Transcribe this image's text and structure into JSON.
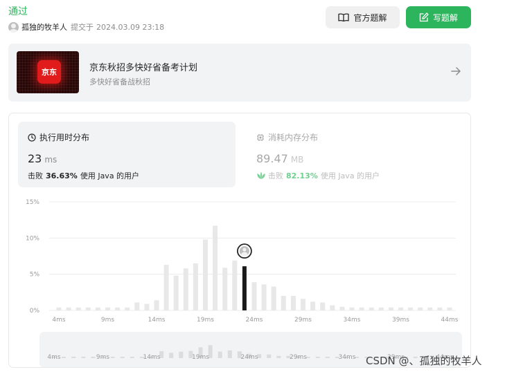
{
  "header": {
    "status": "通过",
    "username": "孤独的牧羊人",
    "submitted_label": "提交于",
    "submitted_time": "2024.03.09 23:18",
    "official_solution_label": "官方题解",
    "write_solution_label": "写题解"
  },
  "promo": {
    "logo_text": "京东",
    "title": "京东秋招多快好省备考计划",
    "subtitle": "多快好省备战秋招"
  },
  "tabs": {
    "runtime": {
      "title": "执行用时分布",
      "value": "23",
      "unit": "ms",
      "beat_prefix": "击败",
      "beat_pct": "36.63%",
      "beat_suffix": "使用 Java 的用户"
    },
    "memory": {
      "title": "消耗内存分布",
      "value": "89.47",
      "unit": "MB",
      "beat_prefix": "击败",
      "beat_pct": "82.13%",
      "beat_suffix": "使用 Java 的用户"
    }
  },
  "chart_data": {
    "type": "bar",
    "x_unit": "ms",
    "x_start": 4,
    "x_step": 1,
    "values": [
      0.4,
      0.4,
      0.4,
      0.4,
      0.4,
      0.4,
      0.4,
      0.4,
      1.1,
      0.9,
      1.4,
      6.3,
      4.8,
      5.8,
      6.5,
      9.8,
      11.7,
      5.9,
      6.9,
      6.1,
      3.9,
      3.6,
      3.3,
      2.0,
      2.0,
      1.6,
      1.2,
      1.1,
      0.7,
      0.5,
      0.4,
      0.4,
      0.4,
      0.4,
      0.4,
      0.4,
      0.4,
      0.4,
      0.4,
      0.4,
      0.4
    ],
    "highlight_x": 23,
    "yticks": [
      "0%",
      "5%",
      "10%",
      "15%"
    ],
    "ylim": [
      0,
      15
    ],
    "xticks": [
      "4ms",
      "9ms",
      "14ms",
      "19ms",
      "24ms",
      "29ms",
      "34ms",
      "39ms",
      "44ms"
    ],
    "colors": {
      "bar": "#e8e8e8",
      "highlight": "#1a1a1a",
      "grid": "#ececec"
    }
  },
  "watermark": "CSDN @、孤独的牧羊人"
}
